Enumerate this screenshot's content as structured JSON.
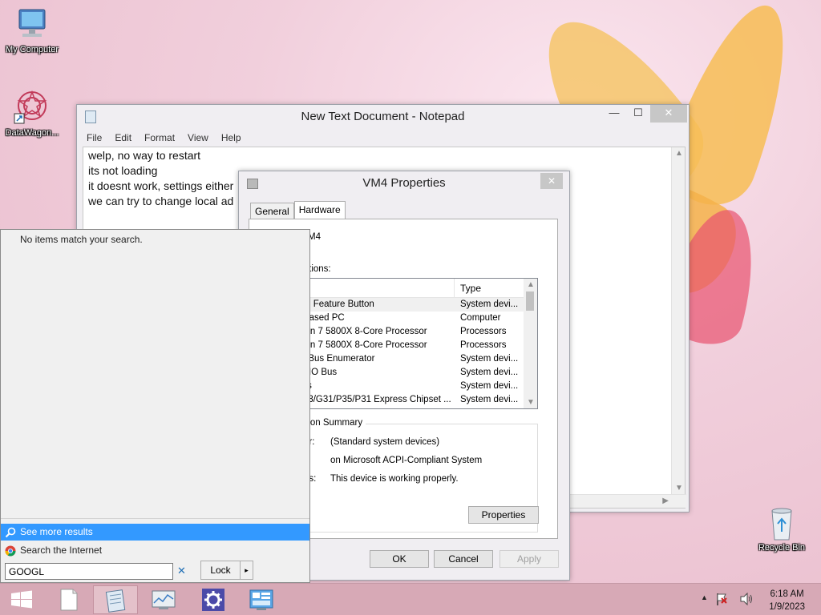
{
  "desktop": {
    "icons": [
      {
        "label": "My Computer",
        "icon": "my-computer-icon"
      },
      {
        "label": "DataWagon...",
        "icon": "datawagon-shortcut-icon"
      },
      {
        "label": "Recycle Bin",
        "icon": "recycle-bin-icon"
      }
    ]
  },
  "notepad": {
    "title": "New Text Document - Notepad",
    "menu": [
      "File",
      "Edit",
      "Format",
      "View",
      "Help"
    ],
    "lines": [
      "welp, no way to restart",
      "its not loading",
      "it doesnt work, settings either",
      "we can try to change local ad"
    ],
    "controls": {
      "minimize": "—",
      "maximize": "☐",
      "close": "✕"
    }
  },
  "properties": {
    "title": "VM4 Properties",
    "close": "✕",
    "tabs": [
      "General",
      "Hardware"
    ],
    "active_tab": "Hardware",
    "device_name": "M4",
    "functions_label": "nctions:",
    "columns": [
      "",
      "Type"
    ],
    "devices": [
      {
        "name": "ked Feature Button",
        "type": "System devi..."
      },
      {
        "name": "4-based PC",
        "type": "Computer"
      },
      {
        "name": "yzen 7 5800X 8-Core Processor",
        "type": "Processors"
      },
      {
        "name": "yzen 7 5800X 8-Core Processor",
        "type": "Processors"
      },
      {
        "name": "ite Bus Enumerator",
        "type": "System devi..."
      },
      {
        "name": "ed IO Bus",
        "type": "System devi..."
      },
      {
        "name": "Bus",
        "type": "System devi..."
      },
      {
        "name": "G33/G31/P35/P31 Express Chipset ...",
        "type": "System devi..."
      }
    ],
    "summary": {
      "legend": "nction Summary",
      "rows": [
        {
          "label": "er:",
          "value": "(Standard system devices)"
        },
        {
          "label": "",
          "value": "on Microsoft ACPI-Compliant System"
        },
        {
          "label": "us:",
          "value": "This device is working properly."
        }
      ]
    },
    "buttons": {
      "properties": "Properties",
      "ok": "OK",
      "cancel": "Cancel",
      "apply": "Apply"
    }
  },
  "search_panel": {
    "no_items": "No items match your search.",
    "see_more": "See more results",
    "search_internet": "Search the Internet",
    "query": "GOOGL",
    "clear": "✕",
    "lock": "Lock",
    "lock_arrow": "▸"
  },
  "taskbar": {
    "items": [
      "start-button-icon",
      "new-document-icon",
      "notepad-icon",
      "system-monitor-icon",
      "settings-gear-icon",
      "control-panel-icon"
    ],
    "active_item": "notepad-icon",
    "time": "6:18 AM",
    "date": "1/9/2023",
    "tray": [
      "show-hidden-icons-arrow",
      "action-center-flag-icon",
      "volume-icon"
    ]
  },
  "colors": {
    "accent": "#3399ff",
    "taskbar": "#d7a9b6",
    "gear_tile": "#4b4aa8"
  }
}
